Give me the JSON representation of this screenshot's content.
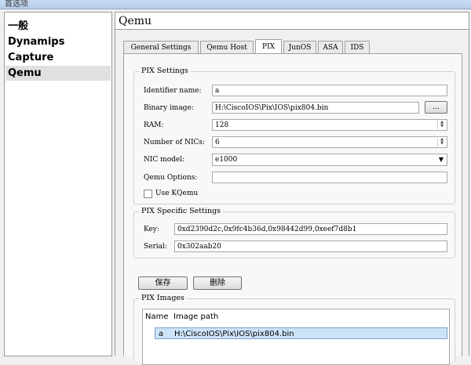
{
  "window": {
    "title_fragment": "首选项"
  },
  "sidebar": {
    "items": [
      {
        "label": "一般"
      },
      {
        "label": "Dynamips"
      },
      {
        "label": "Capture"
      },
      {
        "label": "Qemu"
      }
    ],
    "selected": "Qemu"
  },
  "panel": {
    "title": "Qemu",
    "tabs": [
      {
        "label": "General Settings"
      },
      {
        "label": "Qemu Host"
      },
      {
        "label": "PIX"
      },
      {
        "label": "JunOS"
      },
      {
        "label": "ASA"
      },
      {
        "label": "IDS"
      }
    ],
    "active_tab": "PIX"
  },
  "pix_settings": {
    "title": "PIX Settings",
    "identifier_label": "Identifier name:",
    "identifier_value": "a",
    "binary_label": "Binary image:",
    "binary_value": "H:\\CiscoIOS\\Pix\\IOS\\pix804.bin",
    "browse_label": "...",
    "ram_label": "RAM:",
    "ram_value": "128",
    "nics_label": "Number of NICs:",
    "nics_value": "6",
    "nic_model_label": "NIC model:",
    "nic_model_value": "e1000",
    "qemu_options_label": "Qemu Options:",
    "qemu_options_value": "",
    "kqemu_label": "Use KQemu",
    "kqemu_checked": false
  },
  "pix_specific": {
    "title": "PIX Specific Settings",
    "key_label": "Key:",
    "key_value": "0xd2390d2c,0x9fc4b36d,0x98442d99,0xeef7d8b1",
    "serial_label": "Serial:",
    "serial_value": "0x302aab20"
  },
  "actions": {
    "save_label": "保存",
    "delete_label": "删除"
  },
  "pix_images": {
    "title": "PIX Images",
    "columns": [
      "Name",
      "Image path"
    ],
    "rows": [
      {
        "name": "a",
        "path": "H:\\CiscoIOS\\Pix\\IOS\\pix804.bin"
      }
    ]
  },
  "icons": {
    "spin": "spin-arrows-icon",
    "dropdown": "chevron-down-icon"
  }
}
